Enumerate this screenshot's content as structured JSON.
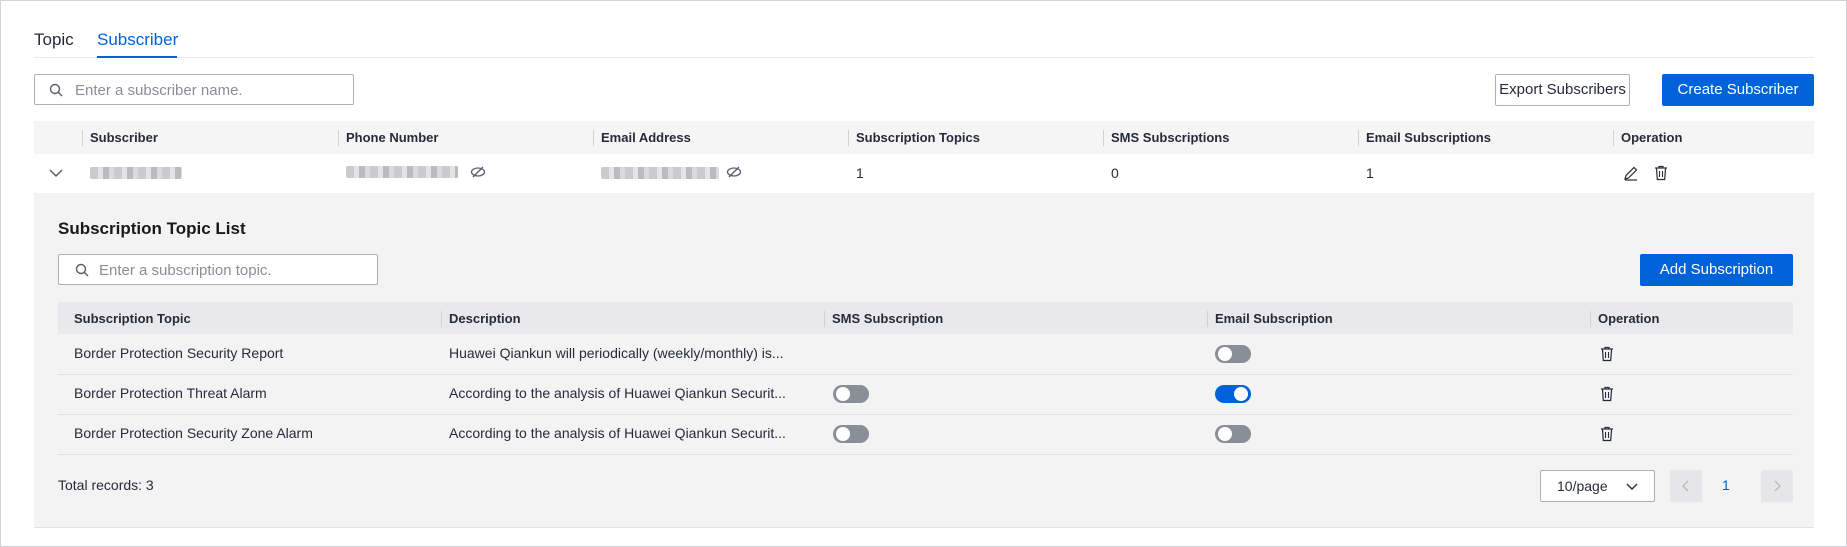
{
  "tabs": [
    {
      "label": "Topic",
      "active": false
    },
    {
      "label": "Subscriber",
      "active": true
    }
  ],
  "search": {
    "placeholder": "Enter a subscriber name."
  },
  "toolbar": {
    "export_label": "Export Subscribers",
    "create_label": "Create Subscriber"
  },
  "table": {
    "columns": [
      "Subscriber",
      "Phone Number",
      "Email Address",
      "Subscription Topics",
      "SMS Subscriptions",
      "Email Subscriptions",
      "Operation"
    ],
    "rows": [
      {
        "subscription_topics": "1",
        "sms_subscriptions": "0",
        "email_subscriptions": "1"
      }
    ]
  },
  "expanded": {
    "title": "Subscription Topic List",
    "search_placeholder": "Enter a subscription topic.",
    "add_label": "Add Subscription",
    "columns": [
      "Subscription Topic",
      "Description",
      "SMS Subscription",
      "Email Subscription",
      "Operation"
    ],
    "rows": [
      {
        "topic": "Border Protection Security Report",
        "description": "Huawei Qiankun will periodically (weekly/monthly) is...",
        "sms": null,
        "email": false
      },
      {
        "topic": "Border Protection Threat Alarm",
        "description": "According to the analysis of Huawei Qiankun Securit...",
        "sms": false,
        "email": true
      },
      {
        "topic": "Border Protection Security Zone Alarm",
        "description": "According to the analysis of Huawei Qiankun Securit...",
        "sms": false,
        "email": false
      }
    ],
    "total": "Total records: 3",
    "page_size": "10/page",
    "current_page": "1"
  },
  "colors": {
    "primary": "#0062d9",
    "toggle_off": "#8a8e99"
  }
}
